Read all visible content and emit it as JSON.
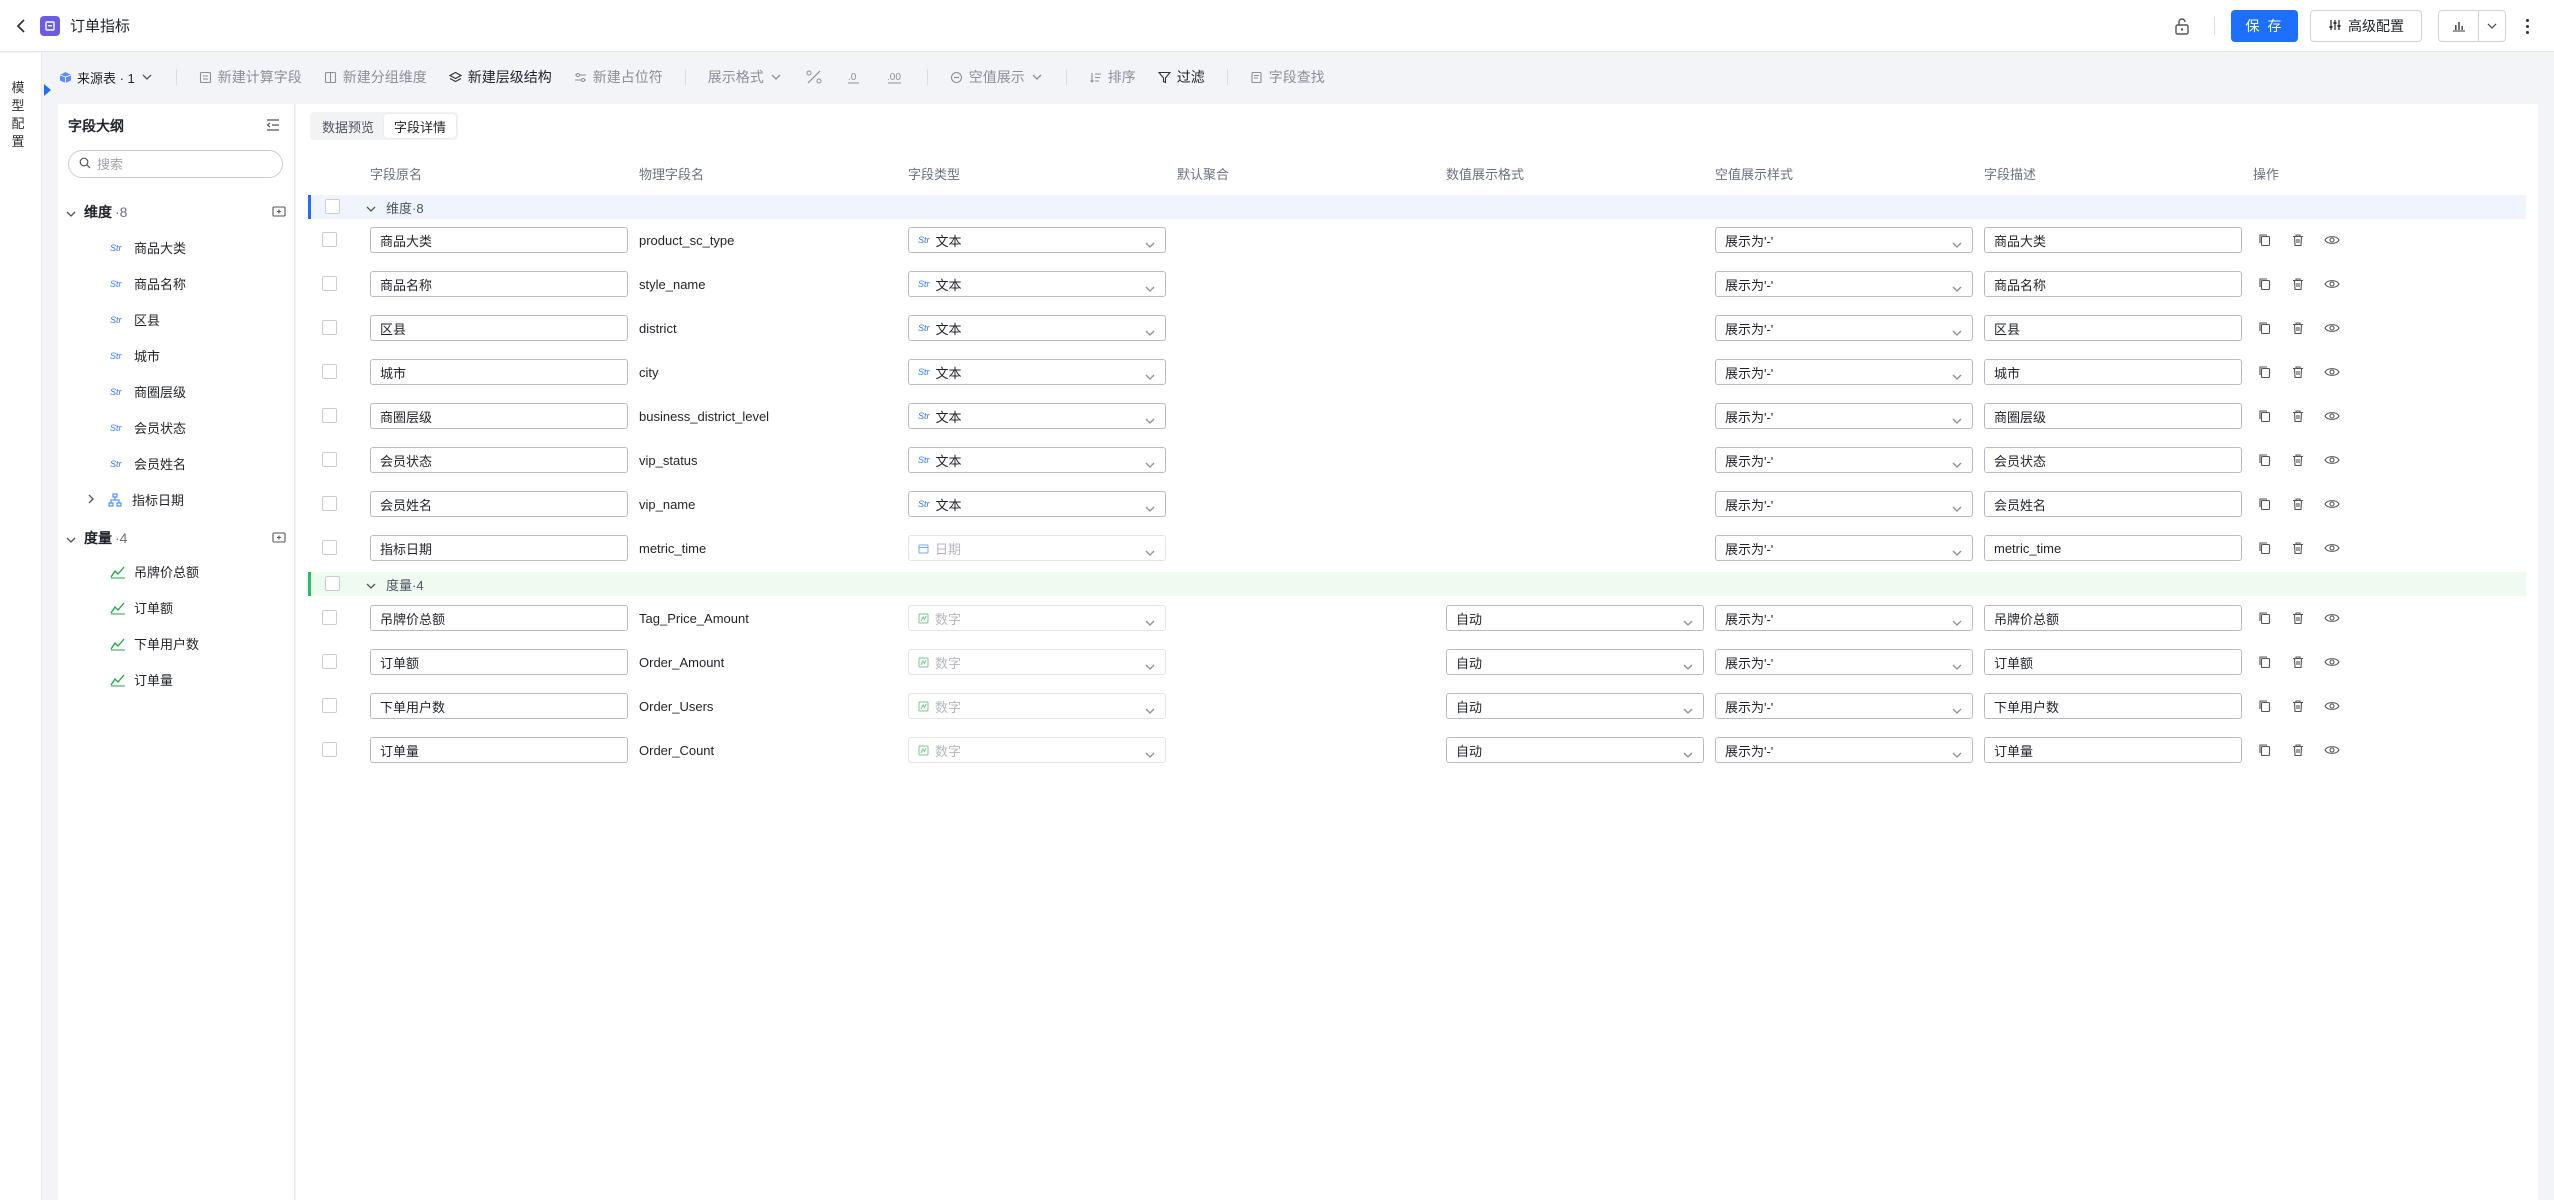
{
  "header": {
    "title": "订单指标",
    "save_label": "保 存",
    "advanced_label": "高级配置"
  },
  "rail": {
    "label": "模型配置"
  },
  "toolbar": {
    "source": "来源表 · 1",
    "new_calc": "新建计算字段",
    "new_group": "新建分组维度",
    "new_hier": "新建层级结构",
    "new_placeholder": "新建占位符",
    "display_format": "展示格式",
    "null_display": "空值展示",
    "sort": "排序",
    "filter": "过滤",
    "field_search": "字段查找"
  },
  "outline": {
    "title": "字段大纲",
    "search_placeholder": "搜索",
    "dim_group": {
      "name": "维度",
      "count": "·8"
    },
    "dims": [
      "商品大类",
      "商品名称",
      "区县",
      "城市",
      "商圈层级",
      "会员状态",
      "会员姓名"
    ],
    "dim_type": "Str",
    "metric_date": "指标日期",
    "mea_group": {
      "name": "度量",
      "count": "·4"
    },
    "measures": [
      "吊牌价总额",
      "订单额",
      "下单用户数",
      "订单量"
    ]
  },
  "tabs": [
    "数据预览",
    "字段详情"
  ],
  "table": {
    "headers": [
      "字段原名",
      "物理字段名",
      "字段类型",
      "默认聚合",
      "数值展示格式",
      "空值展示样式",
      "字段描述",
      "操作"
    ],
    "dim_group_label": "维度·8",
    "mea_group_label": "度量·4",
    "type_str_badge": "Str",
    "dim_rows": [
      {
        "name": "商品大类",
        "physical": "product_sc_type",
        "type": "文本",
        "null_style": "展示为'-'",
        "desc": "商品大类"
      },
      {
        "name": "商品名称",
        "physical": "style_name",
        "type": "文本",
        "null_style": "展示为'-'",
        "desc": "商品名称"
      },
      {
        "name": "区县",
        "physical": "district",
        "type": "文本",
        "null_style": "展示为'-'",
        "desc": "区县"
      },
      {
        "name": "城市",
        "physical": "city",
        "type": "文本",
        "null_style": "展示为'-'",
        "desc": "城市"
      },
      {
        "name": "商圈层级",
        "physical": "business_district_level",
        "type": "文本",
        "null_style": "展示为'-'",
        "desc": "商圈层级"
      },
      {
        "name": "会员状态",
        "physical": "vip_status",
        "type": "文本",
        "null_style": "展示为'-'",
        "desc": "会员状态"
      },
      {
        "name": "会员姓名",
        "physical": "vip_name",
        "type": "文本",
        "null_style": "展示为'-'",
        "desc": "会员姓名"
      },
      {
        "name": "指标日期",
        "physical": "metric_time",
        "type": "日期",
        "null_style": "展示为'-'",
        "desc": "metric_time"
      }
    ],
    "mea_rows": [
      {
        "name": "吊牌价总额",
        "physical": "Tag_Price_Amount",
        "type": "数字",
        "format": "自动",
        "null_style": "展示为'-'",
        "desc": "吊牌价总额"
      },
      {
        "name": "订单额",
        "physical": "Order_Amount",
        "type": "数字",
        "format": "自动",
        "null_style": "展示为'-'",
        "desc": "订单额"
      },
      {
        "name": "下单用户数",
        "physical": "Order_Users",
        "type": "数字",
        "format": "自动",
        "null_style": "展示为'-'",
        "desc": "下单用户数"
      },
      {
        "name": "订单量",
        "physical": "Order_Count",
        "type": "数字",
        "format": "自动",
        "null_style": "展示为'-'",
        "desc": "订单量"
      }
    ]
  },
  "colors": {
    "primary": "#1f6fff",
    "dim_accent": "#1f6fff",
    "mea_accent": "#22c55e"
  }
}
